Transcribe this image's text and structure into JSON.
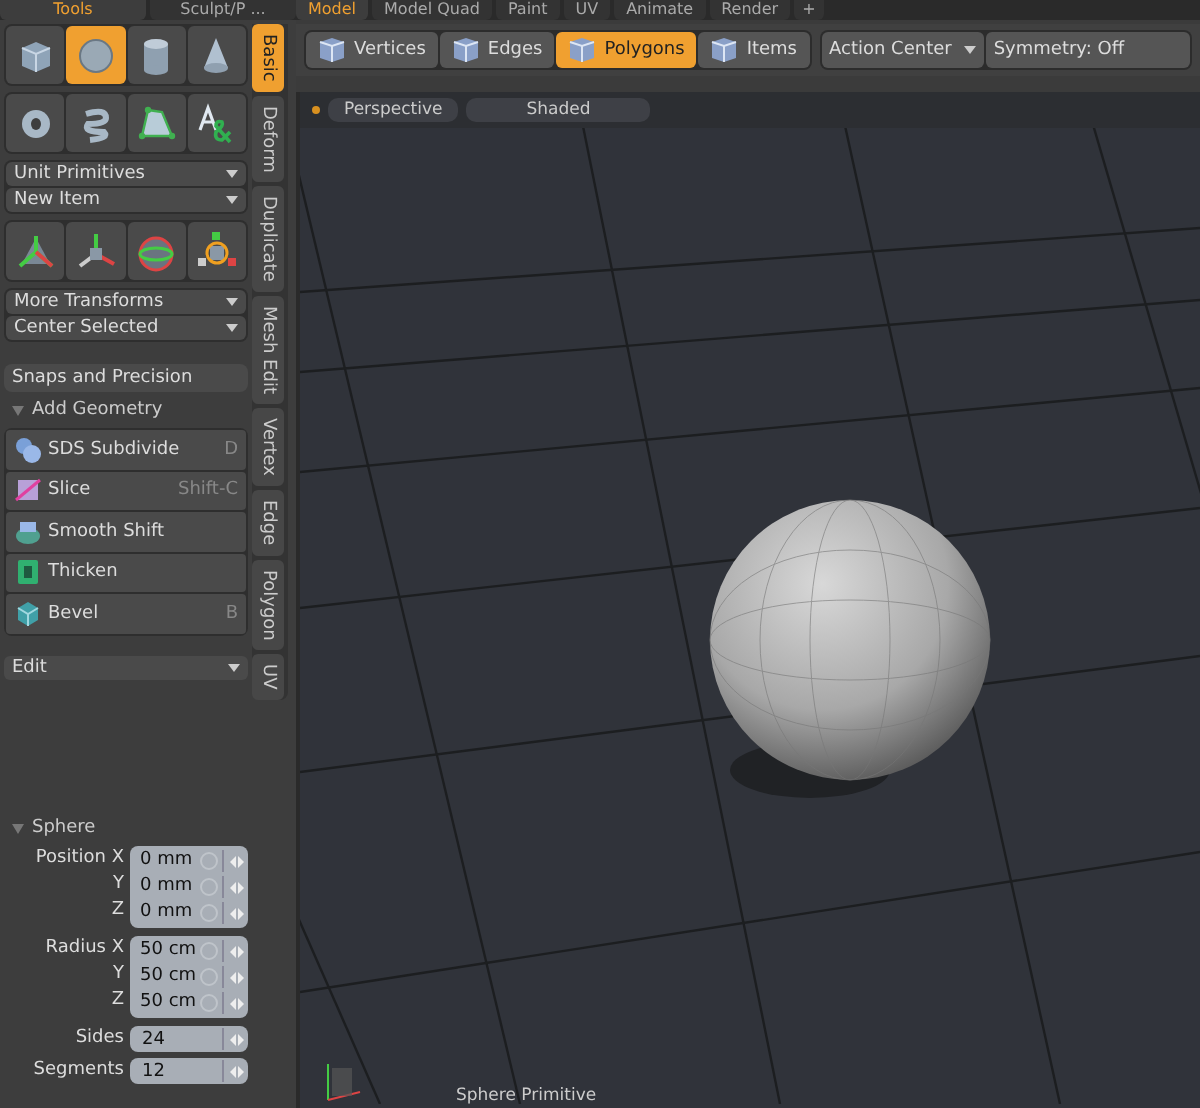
{
  "tool_tabs": [
    {
      "label": "Tools",
      "selected": true
    },
    {
      "label": "Sculpt/P ...",
      "selected": false
    }
  ],
  "layout_tabs": [
    {
      "label": "Model",
      "selected": true
    },
    {
      "label": "Model Quad",
      "selected": false
    },
    {
      "label": "Paint",
      "selected": false
    },
    {
      "label": "UV",
      "selected": false
    },
    {
      "label": "Animate",
      "selected": false
    },
    {
      "label": "Render",
      "selected": false
    }
  ],
  "add_tab_button": "+",
  "primitive_tools": [
    {
      "kind": "cube",
      "selected": false
    },
    {
      "kind": "sphere",
      "selected": true
    },
    {
      "kind": "cylinder",
      "selected": false
    },
    {
      "kind": "cone",
      "selected": false
    },
    {
      "kind": "torus",
      "selected": false
    },
    {
      "kind": "spiral",
      "selected": false
    },
    {
      "kind": "pen",
      "selected": false
    },
    {
      "kind": "text",
      "selected": false
    }
  ],
  "primitive_dropdowns": [
    "Unit Primitives",
    "New Item"
  ],
  "transform_tools": [
    {
      "kind": "move"
    },
    {
      "kind": "axis"
    },
    {
      "kind": "rotate"
    },
    {
      "kind": "scale"
    }
  ],
  "transform_dropdowns": [
    "More Transforms",
    "Center Selected"
  ],
  "snaps_button": "Snaps and Precision",
  "add_geometry": {
    "title": "Add Geometry",
    "expanded": true,
    "items": [
      {
        "kind": "subdivide",
        "label": "SDS Subdivide",
        "shortcut": "D"
      },
      {
        "kind": "slice",
        "label": "Slice",
        "shortcut": "Shift-C"
      },
      {
        "kind": "smooth-shift",
        "label": "Smooth Shift"
      },
      {
        "kind": "thicken",
        "label": "Thicken"
      },
      {
        "kind": "bevel",
        "label": "Bevel",
        "shortcut": "B"
      }
    ]
  },
  "edit_dropdown": "Edit",
  "side_tabs": [
    {
      "label": "Basic",
      "selected": true
    },
    {
      "label": "Deform",
      "selected": false
    },
    {
      "label": "Duplicate",
      "selected": false
    },
    {
      "label": "Mesh Edit",
      "selected": false
    },
    {
      "label": "Vertex",
      "selected": false
    },
    {
      "label": "Edge",
      "selected": false
    },
    {
      "label": "Polygon",
      "selected": false
    },
    {
      "label": "UV",
      "selected": false
    }
  ],
  "sphere_properties": {
    "title": "Sphere",
    "expanded": true,
    "groups": [
      {
        "kind": "distance",
        "fields": [
          {
            "label": "Position X",
            "value": "0 mm"
          },
          {
            "label": "Y",
            "value": "0 mm"
          },
          {
            "label": "Z",
            "value": "0 mm"
          }
        ]
      },
      {
        "kind": "distance",
        "fields": [
          {
            "label": "Radius X",
            "value": "50 cm"
          },
          {
            "label": "Y",
            "value": "50 cm"
          },
          {
            "label": "Z",
            "value": "50 cm"
          }
        ]
      },
      {
        "kind": "integer",
        "fields": [
          {
            "label": "Sides",
            "value": "24"
          },
          {
            "label": "Segments",
            "value": "12"
          }
        ]
      }
    ]
  },
  "selection_modes": [
    {
      "label": "Vertices",
      "selected": false
    },
    {
      "label": "Edges",
      "selected": false
    },
    {
      "label": "Polygons",
      "selected": true
    },
    {
      "label": "Items",
      "selected": false
    }
  ],
  "action_center": "Action Center",
  "symmetry": "Symmetry: Off",
  "viewport": {
    "view": "Perspective",
    "shading": "Shaded",
    "status": "Sphere Primitive"
  }
}
